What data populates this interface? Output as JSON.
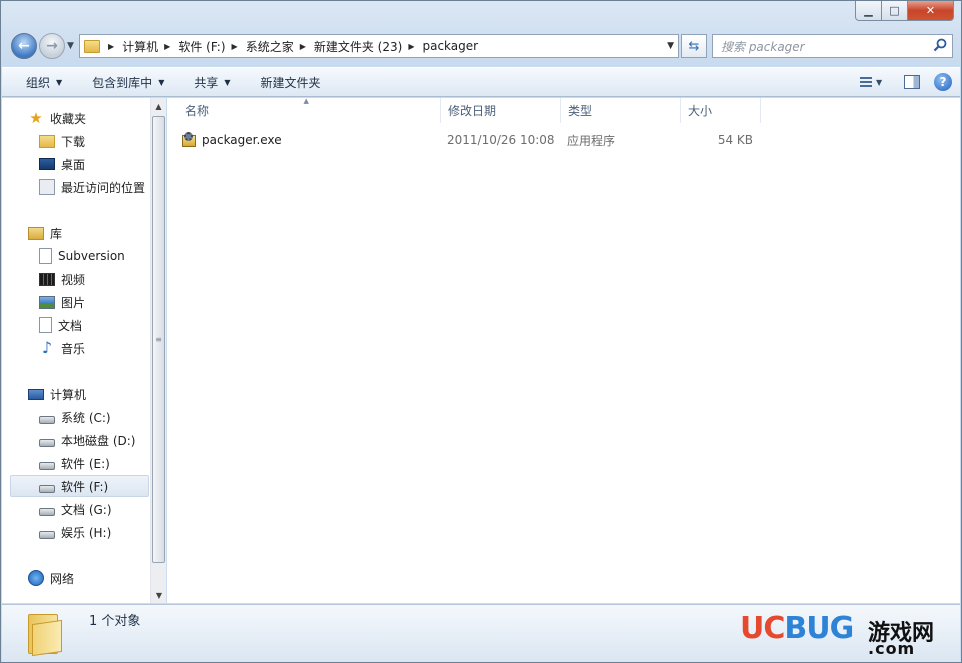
{
  "window": {
    "caption": {
      "minimize": "▁",
      "maximize": "□",
      "close": "✕"
    }
  },
  "address": {
    "crumbs": [
      "计算机",
      "软件 (F:)",
      "系统之家",
      "新建文件夹 (23)",
      "packager"
    ]
  },
  "search": {
    "placeholder": "搜索 packager"
  },
  "toolbar": {
    "organize": "组织",
    "include_in_library": "包含到库中",
    "share": "共享",
    "new_folder": "新建文件夹"
  },
  "sidebar": {
    "favorites": {
      "title": "收藏夹",
      "items": [
        "下载",
        "桌面",
        "最近访问的位置"
      ]
    },
    "libraries": {
      "title": "库",
      "items": [
        "Subversion",
        "视频",
        "图片",
        "文档",
        "音乐"
      ]
    },
    "computer": {
      "title": "计算机",
      "items": [
        "系统 (C:)",
        "本地磁盘 (D:)",
        "软件 (E:)",
        "软件 (F:)",
        "文档 (G:)",
        "娱乐 (H:)"
      ],
      "selected": "软件 (F:)"
    },
    "network": {
      "title": "网络"
    }
  },
  "columns": [
    "名称",
    "修改日期",
    "类型",
    "大小"
  ],
  "files": [
    {
      "name": "packager.exe",
      "modified": "2011/10/26 10:08",
      "type": "应用程序",
      "size": "54 KB"
    }
  ],
  "status": {
    "text": "1 个对象"
  },
  "watermark": {
    "brand_u": "U",
    "brand_c": "C",
    "brand_bug": "BUG",
    "cn": "游戏网",
    "domain": ".com"
  }
}
